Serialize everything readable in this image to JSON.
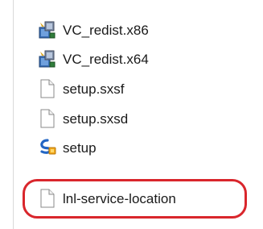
{
  "file_list": {
    "items": [
      {
        "name": "VC_redist.x86",
        "icon": "installer-package-icon"
      },
      {
        "name": "VC_redist.x64",
        "icon": "installer-package-icon"
      },
      {
        "name": "setup.sxsf",
        "icon": "blank-document-icon"
      },
      {
        "name": "setup.sxsd",
        "icon": "blank-document-icon"
      },
      {
        "name": "setup",
        "icon": "setup-app-icon"
      },
      {
        "name": "lnl-service-location",
        "icon": "blank-document-icon"
      }
    ]
  },
  "annotation": {
    "highlight_color": "#d9262c",
    "highlighted_item": "lnl-service-location"
  }
}
